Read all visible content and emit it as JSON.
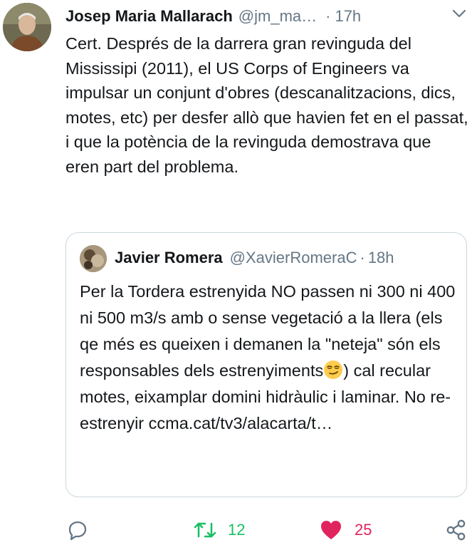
{
  "tweet": {
    "author_name": "Josep Maria Mallarach",
    "author_handle": "@jm_ma…",
    "separator": "·",
    "time": "17h",
    "text": "Cert. Després de la darrera gran revinguda del Mississipi (2011), el US Corps of Engineers va impulsar un conjunt d'obres (descanalitzacions, dics, motes, etc) per desfer allò que havien fet en el passat, i que la potència de la revinguda demostrava que eren part del problema."
  },
  "quote": {
    "author_name": "Javier Romera",
    "author_handle": "@XavierRomeraC",
    "separator": "·",
    "time": "18h",
    "text_before_emoji": "Per la Tordera estrenyida NO passen ni 300 ni 400 ni 500 m3/s amb o sense vegetació a la llera (els qe més es queixen i demanen la \"neteja\" són els responsables dels estrenyiments",
    "text_after_emoji": ") cal recular motes, eixamplar domini hidràulic i laminar. No re-estrenyir",
    "link": "ccma.cat/tv3/alacarta/t…"
  },
  "actions": {
    "retweet_count": "12",
    "like_count": "25"
  },
  "colors": {
    "secondary_text": "#657786",
    "retweet_green": "#17bf63",
    "like_red": "#e0245e",
    "border": "#ccd6dd"
  },
  "icons": [
    "chevron-down-icon",
    "reply-icon",
    "retweet-icon",
    "heart-icon",
    "share-icon"
  ]
}
